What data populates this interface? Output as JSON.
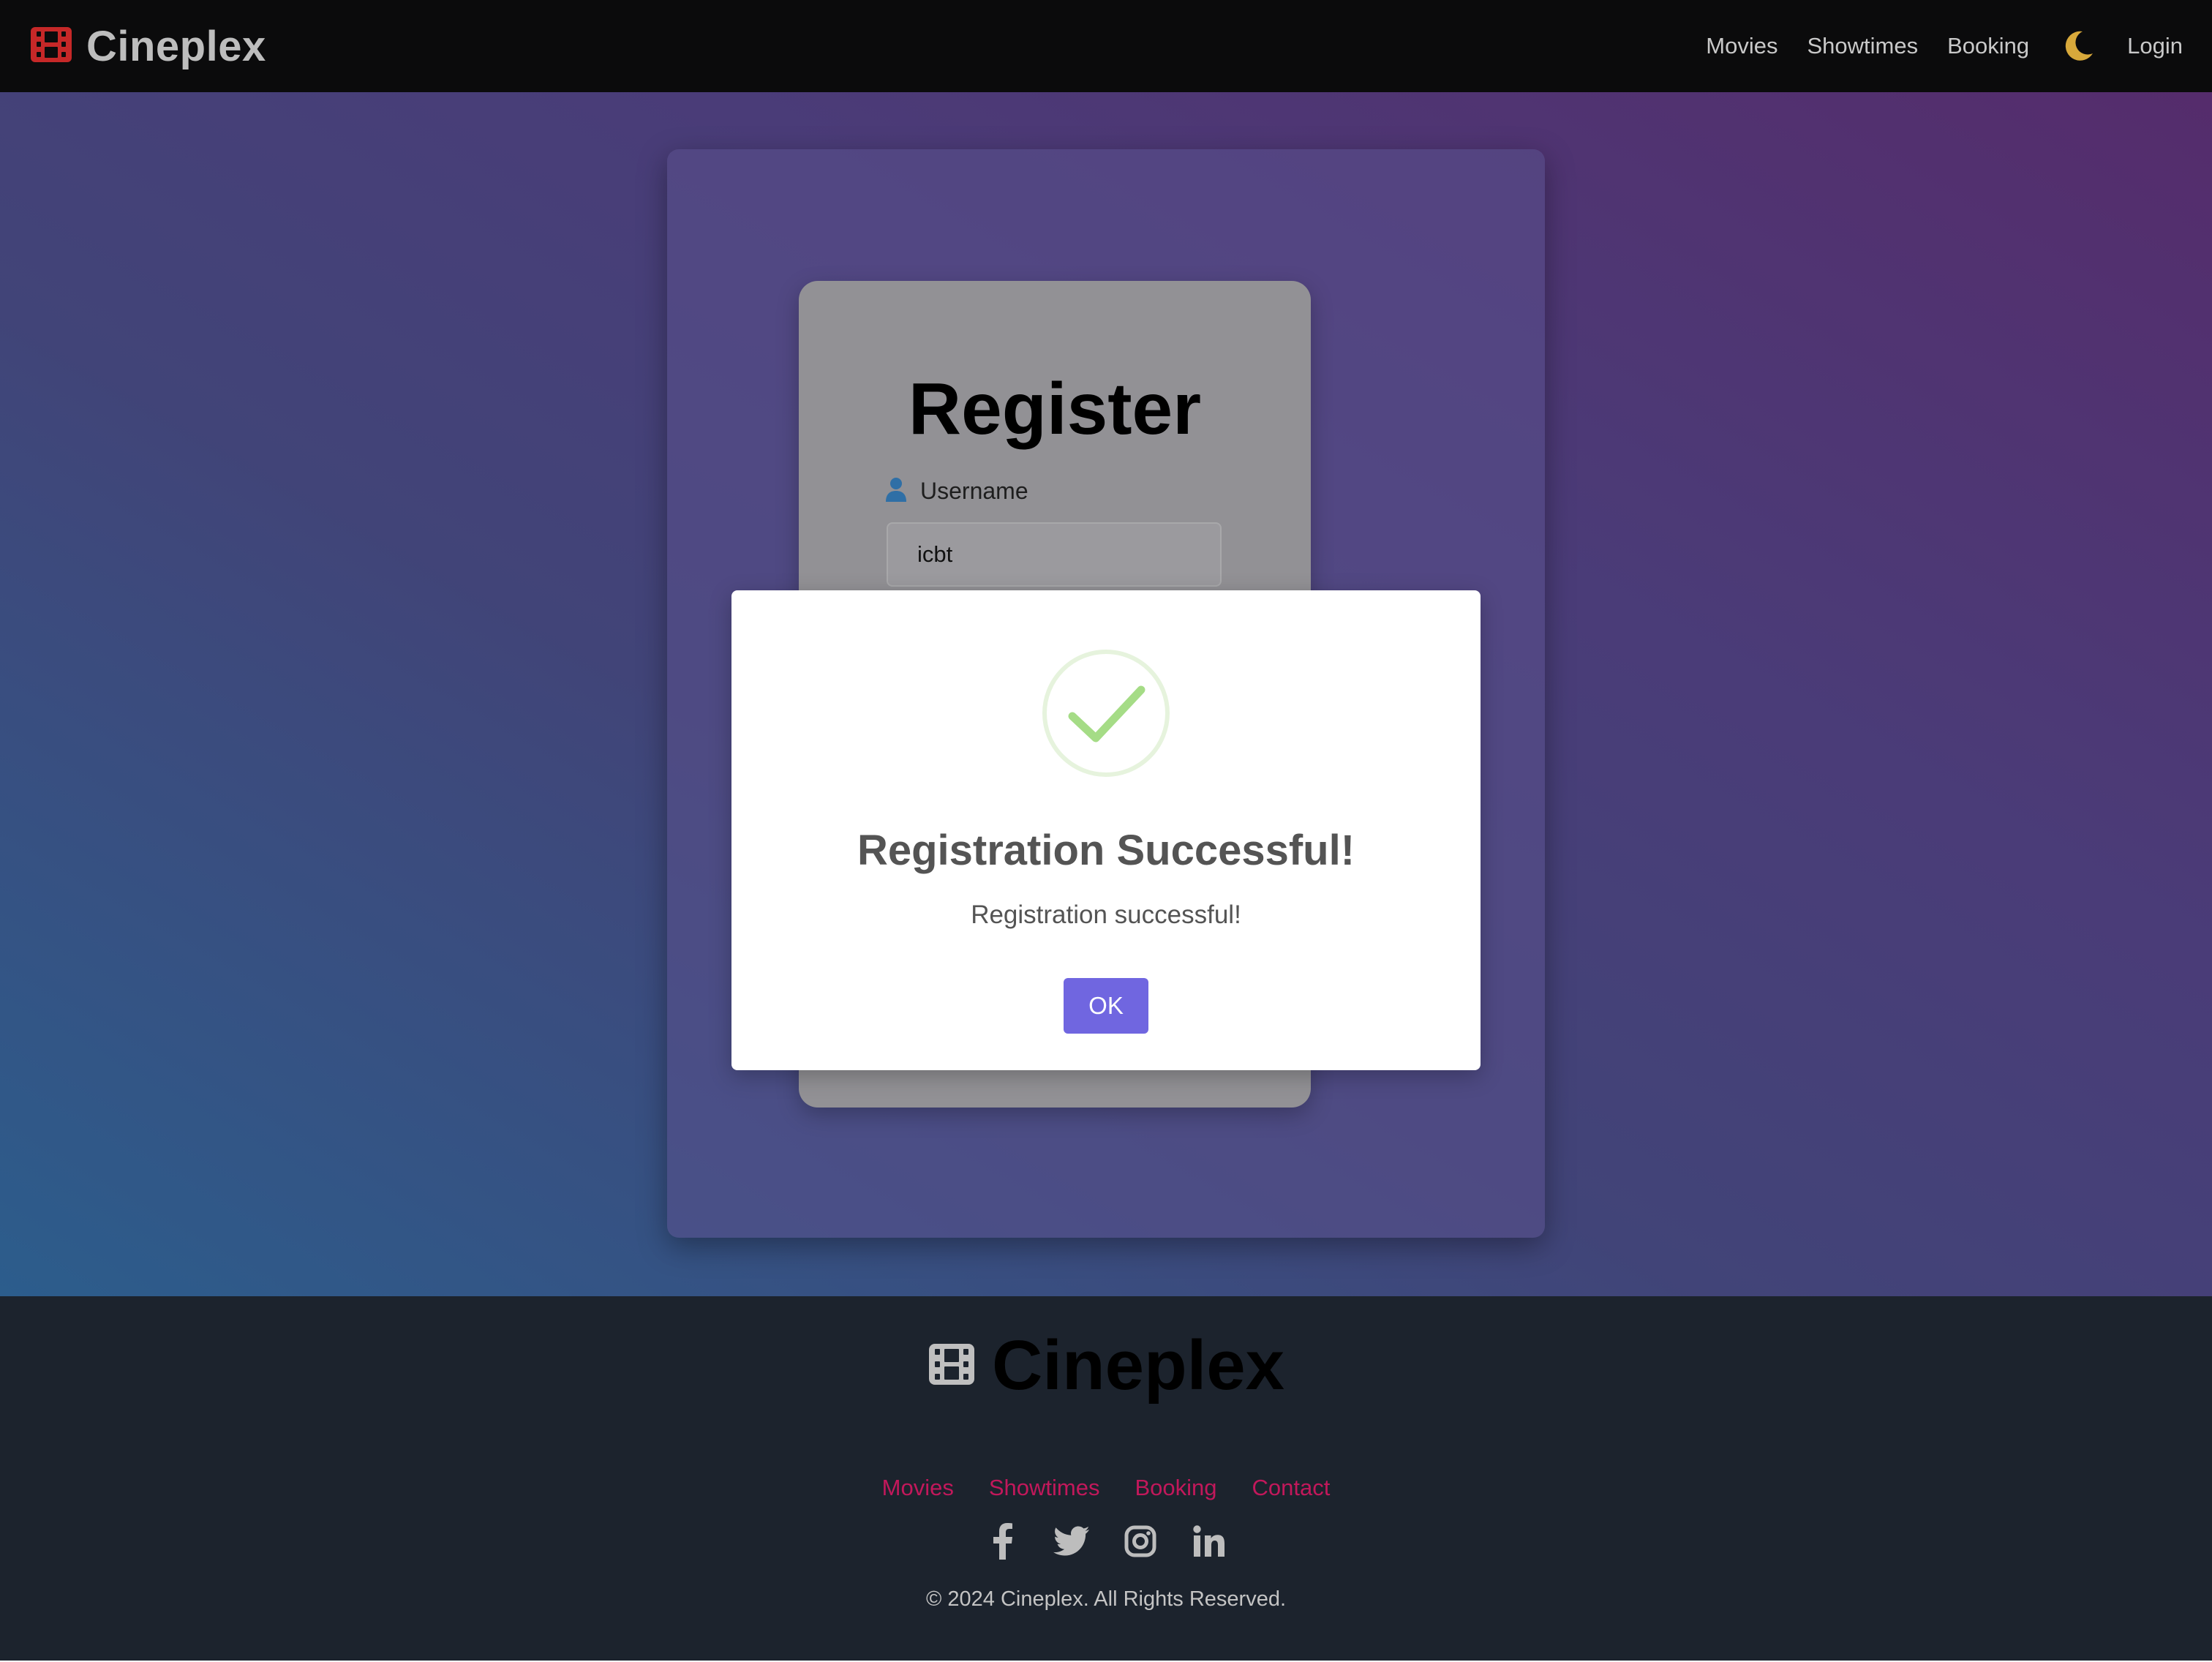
{
  "navbar": {
    "brand": "Cineplex",
    "links": [
      "Movies",
      "Showtimes",
      "Booking"
    ],
    "login_label": "Login",
    "theme_icon": "moon-icon"
  },
  "register_form": {
    "title": "Register",
    "username_label": "Username",
    "username_value": "icbt",
    "username_icon": "user-icon"
  },
  "modal": {
    "icon": "success-check-icon",
    "title": "Registration Successful!",
    "message": "Registration successful!",
    "ok_label": "OK"
  },
  "footer": {
    "brand": "Cineplex",
    "links": [
      "Movies",
      "Showtimes",
      "Booking",
      "Contact"
    ],
    "social_icons": [
      "facebook-icon",
      "twitter-icon",
      "instagram-icon",
      "linkedin-icon"
    ],
    "copyright": "© 2024 Cineplex. All Rights Reserved."
  },
  "colors": {
    "brand_red": "#c62828",
    "navbar_bg": "#0b0b0c",
    "modal_button": "#7066e0",
    "success_green": "#a5dc86",
    "footer_bg": "#1c232d",
    "footer_link": "#c2185b"
  }
}
